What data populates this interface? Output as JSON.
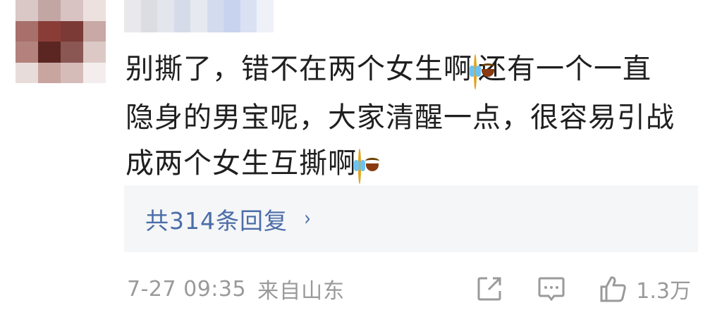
{
  "comment": {
    "line1": "别撕了，错不在两个女生啊",
    "line1b": "还有一个一直",
    "line2": "隐身的男宝呢，大家清醒一点，很容易引战",
    "line3": "成两个女生互撕啊"
  },
  "replies": {
    "label": "共314条回复",
    "chevron": "›"
  },
  "footer": {
    "time": "7-27 09:35",
    "source": "来自山东",
    "like_count": "1.3万"
  },
  "colors": {
    "link": "#4b6da8",
    "muted": "#9a9a9a",
    "text": "#1f1f1f",
    "reply_bg": "#f5f6f8"
  },
  "icons": [
    "crying-laughing-emoji",
    "share-icon",
    "comment-icon",
    "thumbs-up-icon",
    "chevron-right-icon"
  ]
}
